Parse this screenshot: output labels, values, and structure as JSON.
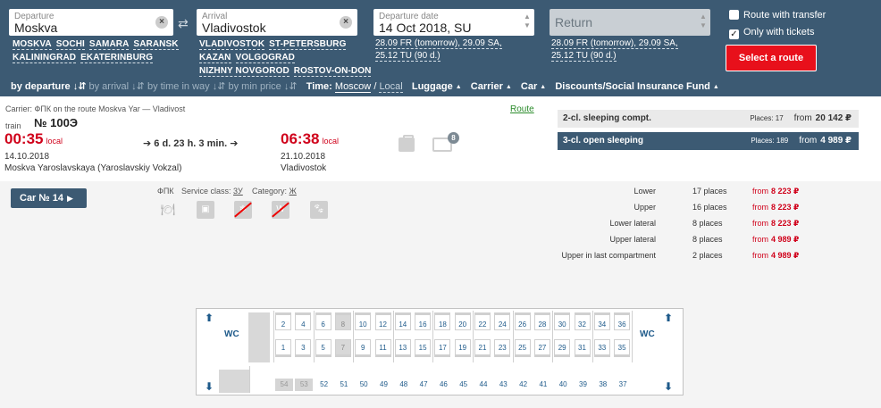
{
  "search": {
    "departure": {
      "label": "Departure",
      "value": "Moskva",
      "quick": [
        "MOSKVA",
        "SOCHI",
        "SAMARA",
        "SARANSK",
        "KALININGRAD",
        "EKATERINBURG"
      ]
    },
    "arrival": {
      "label": "Arrival",
      "value": "Vladivostok",
      "quick": [
        "VLADIVOSTOK",
        "ST-PETERSBURG",
        "KAZAN",
        "VOLGOGRAD",
        "NIZHNY NOVGOROD",
        "ROSTOV-ON-DON"
      ]
    },
    "date": {
      "label": "Departure date",
      "value": "14 Oct 2018, SU",
      "quick_line1": "28.09 FR (tomorrow), 29.09 SA,",
      "quick_line2": "25.12 TU (90 d.)"
    },
    "return": {
      "value": "Return",
      "quick_line1": "28.09 FR (tomorrow), 29.09 SA,",
      "quick_line2": "25.12 TU (90 d.)"
    },
    "route_with_transfer": "Route with transfer",
    "route_with_transfer_checked": false,
    "only_with_tickets": "Only with tickets",
    "only_with_tickets_checked": true,
    "select_route": "Select a route",
    "swap_icon": "swap-arrows-icon",
    "clear_icon": "×"
  },
  "sortbar": {
    "by_departure": "by departure",
    "by_arrival": "by arrival",
    "by_time_in_way": "by time in way",
    "by_min_price": "by min price",
    "sort_glyph": "↓⇵",
    "time_label": "Time:",
    "time_moscow": "Moscow",
    "time_slash": "/",
    "time_local": "Local",
    "luggage": "Luggage",
    "carrier": "Carrier",
    "car": "Car",
    "discounts": "Discounts/Social Insurance Fund",
    "tri": "▲"
  },
  "train": {
    "carrier_line": "Carrier: ФПК    on the route Moskva Yar — Vladivost",
    "route_link": "Route",
    "train_label": "train",
    "number": "№ 100Э",
    "dep_time": "00:35",
    "dep_suffix": "local",
    "arr_time": "06:38",
    "arr_suffix": "local",
    "duration": "➔ 6 d. 23 h. 3 min.  ➔",
    "dep_date": "14.10.2018",
    "arr_date": "21.10.2018",
    "dep_station": "Moskva Yaroslavskaya (Yaroslavskiy Vokzal)",
    "arr_station": "Vladivostok",
    "car_badge": "8"
  },
  "classes": [
    {
      "name": "2-cl. sleeping compt.",
      "places": "Places: 17",
      "from": "from",
      "price": "20 142 ₽"
    },
    {
      "name": "3-cl. open sleeping",
      "places": "Places: 189",
      "from": "from",
      "price": "4 989 ₽"
    }
  ],
  "car": {
    "button": "Car № 14",
    "button_arrow": "▶",
    "carrier": "ФПК",
    "service_label": "Service class:",
    "service_value": "3У",
    "category_label": "Category:",
    "category_value": "Ж",
    "facilities": [
      "food-icon",
      "luggage-icon",
      "no-air-conditioning-icon",
      "no-wc-icon",
      "pet-icon"
    ],
    "prices": [
      {
        "type": "Lower",
        "qty": "17 places",
        "from": "from",
        "price": "8 223 ₽"
      },
      {
        "type": "Upper",
        "qty": "16 places",
        "from": "from",
        "price": "8 223 ₽"
      },
      {
        "type": "Lower lateral",
        "qty": "8 places",
        "from": "from",
        "price": "8 223 ₽"
      },
      {
        "type": "Upper lateral",
        "qty": "8 places",
        "from": "from",
        "price": "4 989 ₽"
      },
      {
        "type": "Upper in last compartment",
        "qty": "2 places",
        "from": "from",
        "price": "4 989 ₽"
      }
    ]
  },
  "schema": {
    "wc_label": "WC",
    "upper_seats": [
      "2",
      "4",
      "6",
      "8",
      "10",
      "12",
      "14",
      "16",
      "18",
      "20",
      "22",
      "24",
      "26",
      "28",
      "30",
      "32",
      "34",
      "36"
    ],
    "lower_seats": [
      "1",
      "3",
      "5",
      "7",
      "9",
      "11",
      "13",
      "15",
      "17",
      "19",
      "21",
      "23",
      "25",
      "27",
      "29",
      "31",
      "33",
      "35"
    ],
    "lateral_seats": [
      "54",
      "53",
      "52",
      "51",
      "50",
      "49",
      "48",
      "47",
      "46",
      "45",
      "44",
      "43",
      "42",
      "41",
      "40",
      "39",
      "38",
      "37"
    ],
    "occupied": [
      "7",
      "8",
      "54",
      "53"
    ]
  }
}
